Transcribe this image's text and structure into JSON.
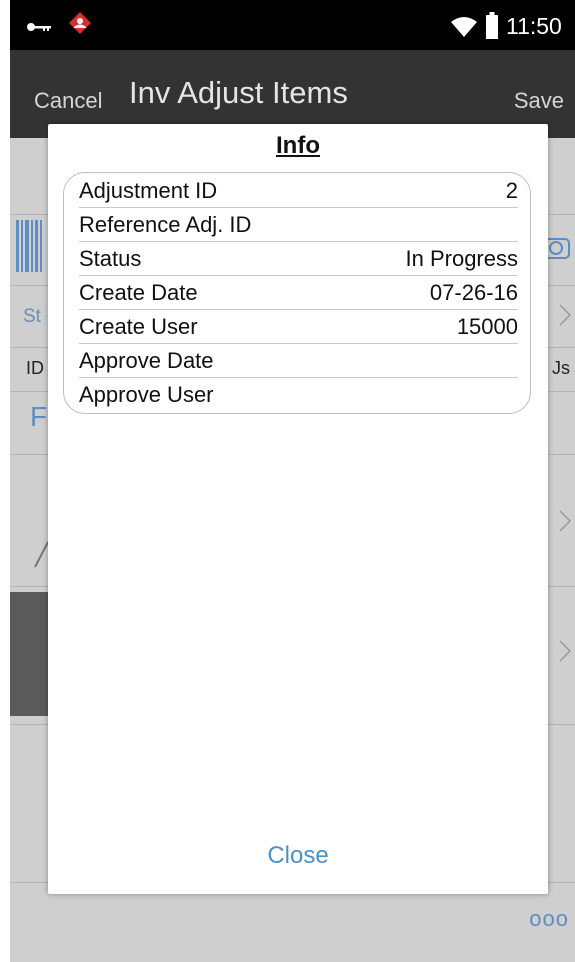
{
  "status_bar": {
    "time": "11:50",
    "icons": [
      "key-icon",
      "app-notification-icon",
      "wifi-icon",
      "battery-icon"
    ]
  },
  "action_bar": {
    "cancel_label": "Cancel",
    "title": "Inv Adjust Items",
    "save_label": "Save"
  },
  "background": {
    "partial_status_label": "St",
    "partial_id_header": "ID",
    "partial_units_header": "Js",
    "partial_link": "F",
    "more_label": "ooo"
  },
  "dialog": {
    "title": "Info",
    "rows": [
      {
        "label": "Adjustment ID",
        "value": "2"
      },
      {
        "label": "Reference Adj. ID",
        "value": ""
      },
      {
        "label": "Status",
        "value": "In Progress"
      },
      {
        "label": "Create Date",
        "value": "07-26-16"
      },
      {
        "label": "Create User",
        "value": "15000"
      },
      {
        "label": "Approve Date",
        "value": ""
      },
      {
        "label": "Approve User",
        "value": ""
      }
    ],
    "close_label": "Close"
  },
  "colors": {
    "action_bar": "#333333",
    "link_blue": "#4a90c8",
    "app_icon_red": "#d32f2f"
  }
}
